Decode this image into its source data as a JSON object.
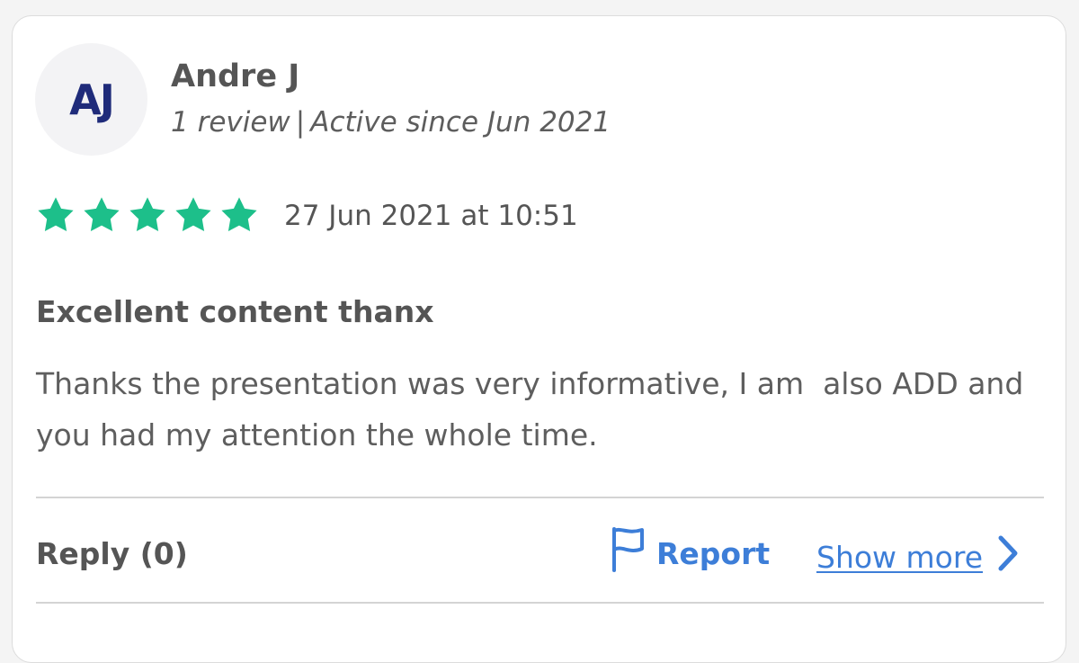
{
  "reviewer": {
    "initials": "AJ",
    "name": "Andre J",
    "review_count": "1 review",
    "separator": "|",
    "active_since": "Active since Jun 2021"
  },
  "rating": {
    "stars": 5,
    "max_stars": 5,
    "star_color": "#1dbf8a"
  },
  "review": {
    "date": "27 Jun 2021 at 10:51",
    "title": "Excellent content thanx",
    "body": "Thanks the presentation was very informative, I am  also ADD and you had my attention the whole time."
  },
  "actions": {
    "reply_label": "Reply (0)",
    "report_label": "Report",
    "report_icon": "flag-icon",
    "show_more_label": "Show more",
    "show_more_icon": "chevron-right-icon",
    "link_color": "#3d7ed8"
  }
}
